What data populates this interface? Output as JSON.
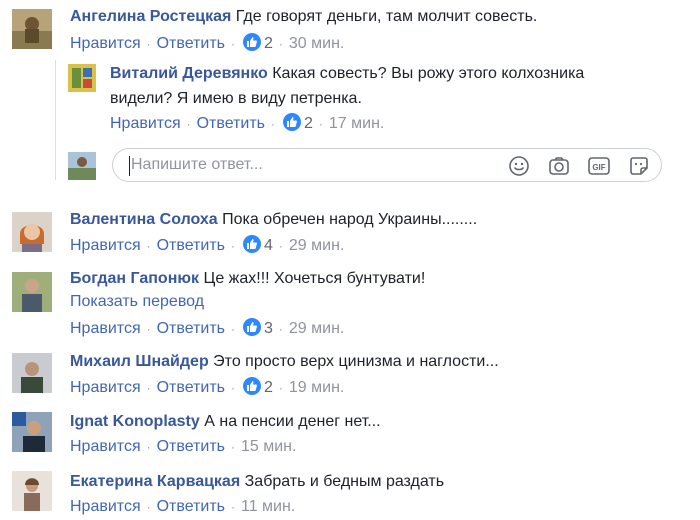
{
  "actions": {
    "like": "Нравится",
    "reply": "Ответить",
    "separator": "·"
  },
  "comments": [
    {
      "author": "Ангелина Ростецкая",
      "text": "Где говорят деньги, там молчит совесть.",
      "likes": "2",
      "time": "30 мин."
    },
    {
      "author": "Виталий Деревянко",
      "text_line1": "Какая совесть? Вы рожу этого колхозника",
      "text_line2": "видели? Я имею в виду петренка.",
      "likes": "2",
      "time": "17 мин."
    },
    {
      "author": "Валентина Солоха",
      "text": "Пока обречен народ Украины........",
      "likes": "4",
      "time": "29 мин."
    },
    {
      "author": "Богдан Гапонюк",
      "text": "Це жах!!! Хочеться бунтувати!",
      "translate": "Показать перевод",
      "likes": "3",
      "time": "29 мин."
    },
    {
      "author": "Михаил Шнайдер",
      "text": "Это просто верх цинизма и наглости...",
      "likes": "2",
      "time": "19 мин."
    },
    {
      "author": "Ignat Konoplasty",
      "text": "А на пенсии денег нет...",
      "time": "15 мин."
    },
    {
      "author": "Екатерина Карвацкая",
      "text": "Забрать и бедным раздать",
      "time": "11 мин."
    }
  ],
  "reply_box": {
    "placeholder": "Напишите ответ...",
    "icons": [
      "emoji-icon",
      "camera-icon",
      "gif-icon",
      "sticker-icon"
    ]
  },
  "colors": {
    "name": "#385898",
    "link": "#4267b2",
    "like_badge": "#2d88ff",
    "muted": "#90949c"
  }
}
